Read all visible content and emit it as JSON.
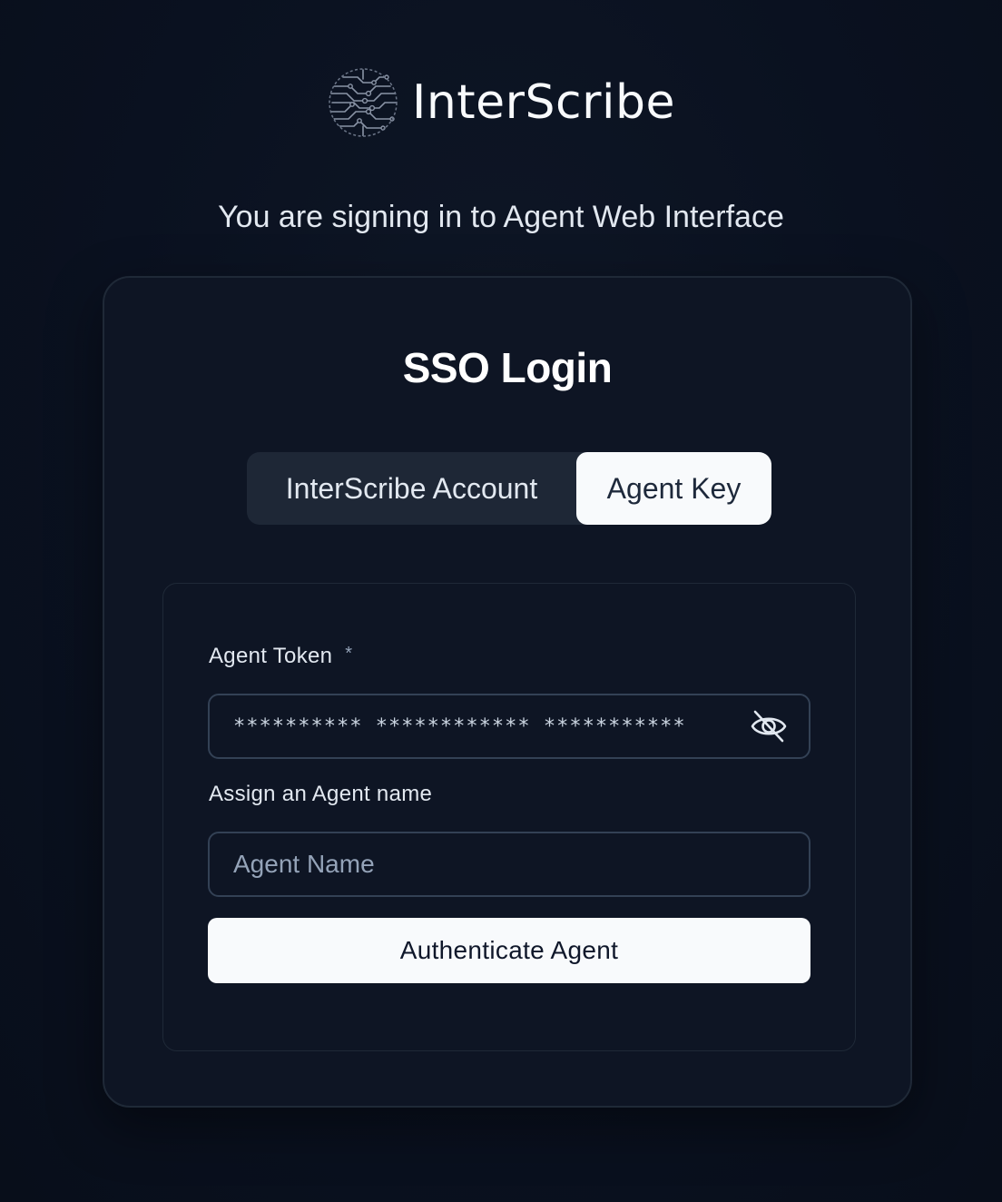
{
  "brand": {
    "name": "InterScribe",
    "logo_icon": "circuit-globe-icon"
  },
  "subtitle": "You are signing in to Agent Web Interface",
  "login": {
    "title": "SSO Login",
    "tabs": [
      {
        "label": "InterScribe Account",
        "active": false
      },
      {
        "label": "Agent Key",
        "active": true
      }
    ],
    "token": {
      "label": "Agent Token",
      "required_marker": "*",
      "value": "********** ************ ***********",
      "toggle_icon": "eye-off-icon"
    },
    "agent_name": {
      "label": "Assign an Agent name",
      "placeholder": "Agent Name",
      "value": ""
    },
    "submit_label": "Authenticate Agent"
  },
  "colors": {
    "background": "#0a1120",
    "card": "#0e1524",
    "tab_inactive": "#1e2736",
    "tab_active": "#f8fafc",
    "button": "#f8fafc"
  }
}
